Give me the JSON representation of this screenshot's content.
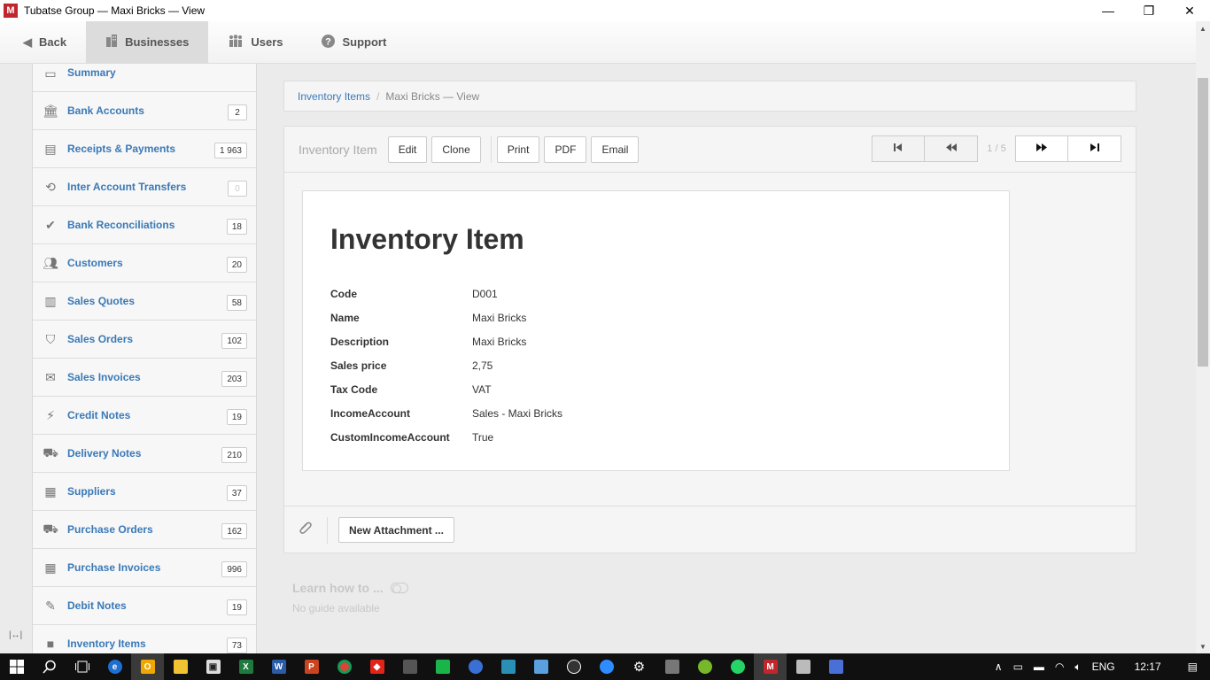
{
  "window": {
    "logo_letter": "M",
    "title": "Tubatse Group — Maxi Bricks — View",
    "minimize": "—",
    "restore": "❐",
    "close": "✕"
  },
  "topnav": {
    "back": "Back",
    "businesses": "Businesses",
    "users": "Users",
    "support": "Support"
  },
  "sidebar": {
    "items": [
      {
        "label": "Summary",
        "badge": "",
        "icon": "summary-icon"
      },
      {
        "label": "Bank Accounts",
        "badge": "2",
        "icon": "bank-icon"
      },
      {
        "label": "Receipts & Payments",
        "badge": "1 963",
        "icon": "receipts-icon"
      },
      {
        "label": "Inter Account Transfers",
        "badge": "0",
        "icon": "transfer-icon"
      },
      {
        "label": "Bank Reconciliations",
        "badge": "18",
        "icon": "check-icon"
      },
      {
        "label": "Customers",
        "badge": "20",
        "icon": "customers-icon"
      },
      {
        "label": "Sales Quotes",
        "badge": "58",
        "icon": "quotes-icon"
      },
      {
        "label": "Sales Orders",
        "badge": "102",
        "icon": "basket-icon"
      },
      {
        "label": "Sales Invoices",
        "badge": "203",
        "icon": "invoice-icon"
      },
      {
        "label": "Credit Notes",
        "badge": "19",
        "icon": "lightning-icon"
      },
      {
        "label": "Delivery Notes",
        "badge": "210",
        "icon": "truck-icon"
      },
      {
        "label": "Suppliers",
        "badge": "37",
        "icon": "suppliers-icon"
      },
      {
        "label": "Purchase Orders",
        "badge": "162",
        "icon": "cart-icon"
      },
      {
        "label": "Purchase Invoices",
        "badge": "996",
        "icon": "calendar-icon"
      },
      {
        "label": "Debit Notes",
        "badge": "19",
        "icon": "debit-icon"
      },
      {
        "label": "Inventory Items",
        "badge": "73",
        "icon": "box-icon"
      }
    ]
  },
  "breadcrumb": {
    "link": "Inventory Items",
    "separator": "/",
    "current": "Maxi Bricks — View"
  },
  "toolbar": {
    "title": "Inventory Item",
    "edit": "Edit",
    "clone": "Clone",
    "print": "Print",
    "pdf": "PDF",
    "email": "Email",
    "page_count": "1 / 5"
  },
  "document": {
    "title": "Inventory Item",
    "fields": [
      {
        "label": "Code",
        "value": "D001"
      },
      {
        "label": "Name",
        "value": "Maxi Bricks"
      },
      {
        "label": "Description",
        "value": "Maxi Bricks"
      },
      {
        "label": "Sales price",
        "value": "2,75"
      },
      {
        "label": "Tax Code",
        "value": "VAT"
      },
      {
        "label": "IncomeAccount",
        "value": "Sales - Maxi Bricks"
      },
      {
        "label": "CustomIncomeAccount",
        "value": "True"
      }
    ]
  },
  "attachments": {
    "new_button": "New Attachment ..."
  },
  "learn": {
    "title": "Learn how to ...",
    "subtitle": "No guide available"
  },
  "taskbar": {
    "language": "ENG",
    "time": "12:17"
  }
}
